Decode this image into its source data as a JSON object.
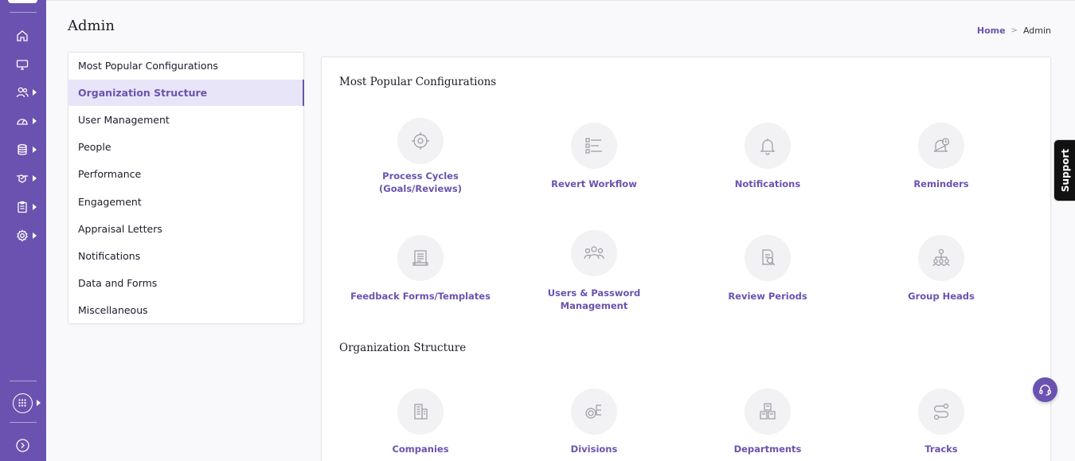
{
  "header": {
    "title": "Admin",
    "breadcrumb": {
      "home": "Home",
      "separator": ">",
      "current": "Admin"
    }
  },
  "rail": {
    "items": [
      {
        "icon": "home-icon"
      },
      {
        "icon": "monitor-icon"
      },
      {
        "icon": "users-icon"
      },
      {
        "icon": "dashboard-gauge-icon"
      },
      {
        "icon": "database-icon"
      },
      {
        "icon": "handshake-icon"
      },
      {
        "icon": "clipboard-icon"
      },
      {
        "icon": "settings-gear-icon"
      }
    ]
  },
  "menu": {
    "items": [
      {
        "label": "Most Popular Configurations"
      },
      {
        "label": "Organization Structure",
        "active": true
      },
      {
        "label": "User Management"
      },
      {
        "label": "People"
      },
      {
        "label": "Performance"
      },
      {
        "label": "Engagement"
      },
      {
        "label": "Appraisal Letters"
      },
      {
        "label": "Notifications"
      },
      {
        "label": "Data and Forms"
      },
      {
        "label": "Miscellaneous"
      }
    ]
  },
  "sections": [
    {
      "title": "Most Popular Configurations",
      "tiles": [
        {
          "label_line1": "Process Cycles",
          "label_line2": "(Goals/Reviews)",
          "icon": "cycle-icon"
        },
        {
          "label_line1": "Revert Workflow",
          "label_line2": "",
          "icon": "workflow-icon"
        },
        {
          "label_line1": "Notifications",
          "label_line2": "",
          "icon": "bell-icon"
        },
        {
          "label_line1": "Reminders",
          "label_line2": "",
          "icon": "bell-clock-icon"
        },
        {
          "label_line1": "Feedback Forms/Templates",
          "label_line2": "",
          "icon": "form-template-icon"
        },
        {
          "label_line1": "Users & Password",
          "label_line2": "Management",
          "icon": "users-group-icon"
        },
        {
          "label_line1": "Review Periods",
          "label_line2": "",
          "icon": "review-document-icon"
        },
        {
          "label_line1": "Group Heads",
          "label_line2": "",
          "icon": "hierarchy-icon"
        }
      ]
    },
    {
      "title": "Organization Structure",
      "tiles": [
        {
          "label_line1": "Companies",
          "label_line2": "",
          "icon": "building-icon"
        },
        {
          "label_line1": "Divisions",
          "label_line2": "",
          "icon": "gear-tree-icon"
        },
        {
          "label_line1": "Departments",
          "label_line2": "",
          "icon": "departments-icon"
        },
        {
          "label_line1": "Tracks",
          "label_line2": "",
          "icon": "track-path-icon"
        }
      ]
    }
  ],
  "support_tab": {
    "label": "Support"
  },
  "colors": {
    "brand": "#6a53b0",
    "active_bg": "#e9e5f8"
  }
}
